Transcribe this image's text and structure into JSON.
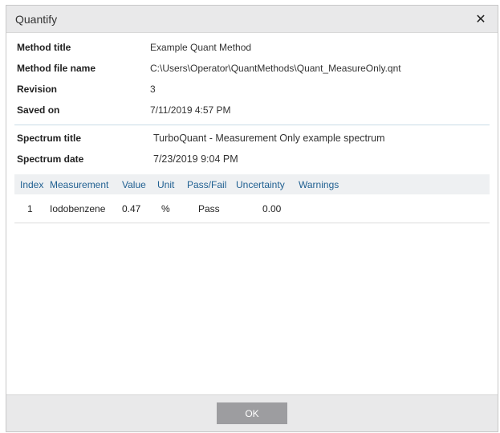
{
  "window": {
    "title": "Quantify"
  },
  "method": {
    "title_label": "Method title",
    "title_value": "Example Quant Method",
    "file_label": "Method file name",
    "file_value": "C:\\Users\\Operator\\QuantMethods\\Quant_MeasureOnly.qnt",
    "revision_label": "Revision",
    "revision_value": "3",
    "saved_label": "Saved on",
    "saved_value": "7/11/2019 4:57 PM"
  },
  "spectrum": {
    "title_label": "Spectrum title",
    "title_value": "TurboQuant - Measurement Only example spectrum",
    "date_label": "Spectrum date",
    "date_value": "7/23/2019 9:04 PM"
  },
  "table": {
    "columns": [
      "Index",
      "Measurement",
      "Value",
      "Unit",
      "Pass/Fail",
      "Uncertainty",
      "Warnings"
    ],
    "rows": [
      [
        "1",
        "Iodobenzene",
        "0.47",
        "%",
        "Pass",
        "0.00",
        ""
      ]
    ]
  },
  "footer": {
    "ok_label": "OK"
  }
}
